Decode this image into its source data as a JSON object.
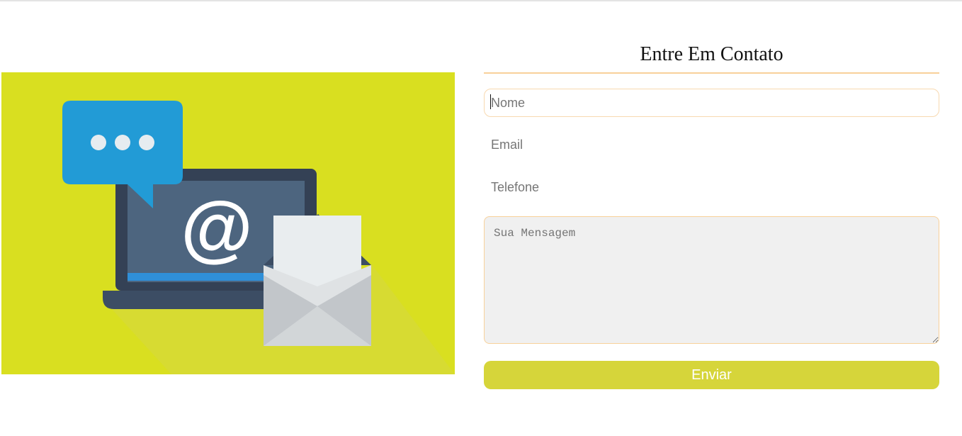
{
  "contact": {
    "title": "Entre Em Contato",
    "name_placeholder": "Nome",
    "email_placeholder": "Email",
    "phone_placeholder": "Telefone",
    "message_placeholder": "Sua Mensagem",
    "submit_label": "Enviar"
  },
  "illustration": {
    "symbol": "@",
    "icons": [
      "chat-bubble-icon",
      "laptop-icon",
      "at-sign-icon",
      "envelope-icon"
    ]
  },
  "colors": {
    "illustration_background": "#d9df20",
    "accent_border": "#f8d19a",
    "button": "#d6d53a",
    "chat_bubble": "#229bd6",
    "laptop_frame": "#344155",
    "laptop_screen": "#4d657f"
  }
}
